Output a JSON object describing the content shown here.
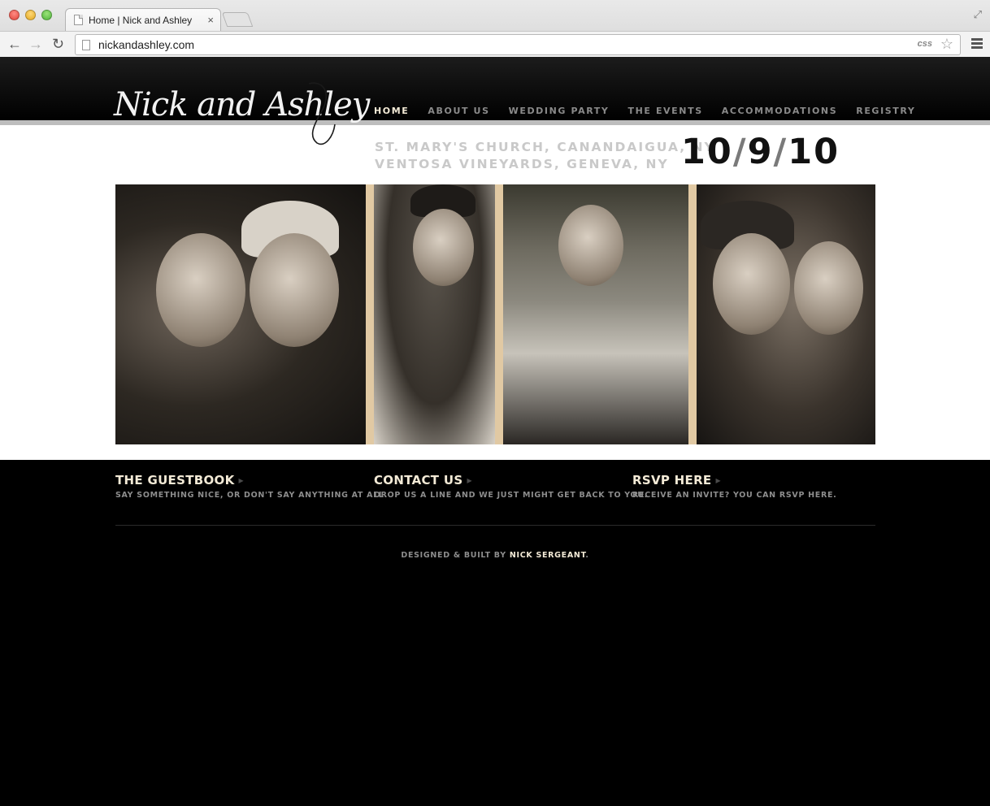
{
  "browser": {
    "tab_title": "Home | Nick and Ashley",
    "tab_close": "×",
    "url": "nickandashley.com",
    "css_badge": "css"
  },
  "site": {
    "logo": "Nick and Ashley",
    "nav": [
      {
        "label": "HOME",
        "active": true
      },
      {
        "label": "ABOUT US",
        "active": false
      },
      {
        "label": "WEDDING PARTY",
        "active": false
      },
      {
        "label": "THE EVENTS",
        "active": false
      },
      {
        "label": "ACCOMMODATIONS",
        "active": false
      },
      {
        "label": "REGISTRY",
        "active": false
      }
    ],
    "venues": [
      "ST. MARY'S CHURCH, CANANDAIGUA, NY",
      "VENTOSA VINEYARDS, GENEVA, NY"
    ],
    "date": {
      "month": "10",
      "day": "9",
      "year": "10",
      "sep": "/"
    },
    "footer_links": [
      {
        "title": "THE GUESTBOOK",
        "desc": "SAY SOMETHING NICE, OR DON'T SAY ANYTHING AT ALL."
      },
      {
        "title": "CONTACT US",
        "desc": "DROP US A LINE AND WE JUST MIGHT GET BACK TO YOU."
      },
      {
        "title": "RSVP HERE",
        "desc": "RECEIVE AN INVITE? YOU CAN RSVP HERE."
      }
    ],
    "credit": {
      "prefix": "DESIGNED & BUILT BY",
      "author": "NICK SERGEANT",
      "suffix": "."
    }
  },
  "colors": {
    "accent": "#f3ead6",
    "muted_text": "#8d8d8d",
    "photo_frame": "#e1c9a3"
  }
}
